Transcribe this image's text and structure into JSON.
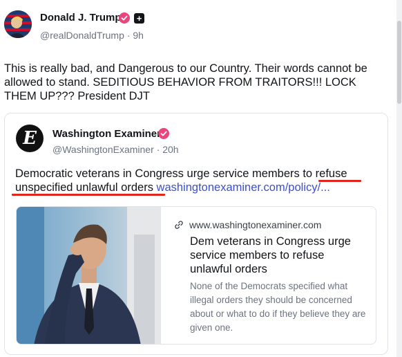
{
  "post": {
    "author_name": "Donald J. Trump",
    "handle": "@realDonaldTrump",
    "time_ago": "9h",
    "separator": "·",
    "text": "This is really bad, and Dangerous to our Country. Their words cannot be allowed to stand. SEDITIOUS BEHAVIOR FROM TRAITORS!!! LOCK THEM UP??? President DJT",
    "verified_icon": "verified-check-icon",
    "extra_badge_icon": "plus-icon"
  },
  "quote": {
    "author_name": "Washington Examiner",
    "handle": "@WashingtonExaminer",
    "time_ago": "20h",
    "separator": "·",
    "text_part1": "Democratic veterans in Congress urge service members to",
    "text_part2": " refuse",
    "text_part3": "unspecified unlawful orders",
    "link_text": " washingtonexaminer.com/policy/...",
    "avatar_letter": "E",
    "link_card": {
      "domain": "www.washingtonexaminer.com",
      "title": "Dem veterans in Congress urge service members to refuse unlawful orders",
      "description": "None of the Democrats specified what illegal orders they should be concerned about or what to do if they believe they are given one.",
      "link_icon": "link-icon"
    }
  },
  "colors": {
    "verified_badge": "#e8467c",
    "underline": "#e0251b",
    "link": "#3b4fd1",
    "muted_text": "#6b7380"
  }
}
